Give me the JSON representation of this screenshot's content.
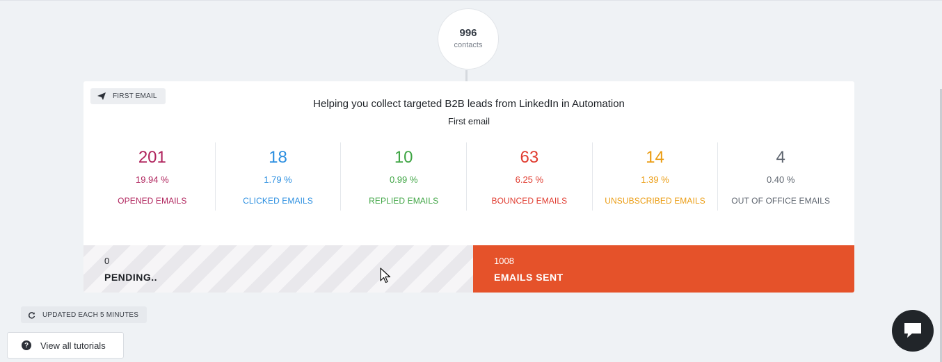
{
  "contacts": {
    "count": "996",
    "label": "contacts"
  },
  "step": {
    "tag_label": "FIRST EMAIL",
    "subject": "Helping you collect targeted B2B leads from LinkedIn in Automation",
    "name": "First email"
  },
  "stats": [
    {
      "count": "201",
      "percent": "19.94 %",
      "label": "OPENED EMAILS",
      "color": "#b0245d"
    },
    {
      "count": "18",
      "percent": "1.79 %",
      "label": "CLICKED EMAILS",
      "color": "#2a8ee0"
    },
    {
      "count": "10",
      "percent": "0.99 %",
      "label": "REPLIED EMAILS",
      "color": "#3fa544"
    },
    {
      "count": "63",
      "percent": "6.25 %",
      "label": "BOUNCED EMAILS",
      "color": "#e03b2f"
    },
    {
      "count": "14",
      "percent": "1.39 %",
      "label": "UNSUBSCRIBED EMAILS",
      "color": "#eb9c12"
    },
    {
      "count": "4",
      "percent": "0.40 %",
      "label": "OUT OF OFFICE EMAILS",
      "color": "#5f6670"
    }
  ],
  "progress": {
    "pending": {
      "count": "0",
      "label": "PENDING..",
      "share": 0.5
    },
    "sent": {
      "count": "1008",
      "label": "EMAILS SENT",
      "share": 0.5,
      "color": "#e5522a"
    }
  },
  "footer": {
    "updated_label": "UPDATED EACH 5 MINUTES",
    "tutorials_label": "View all tutorials"
  }
}
